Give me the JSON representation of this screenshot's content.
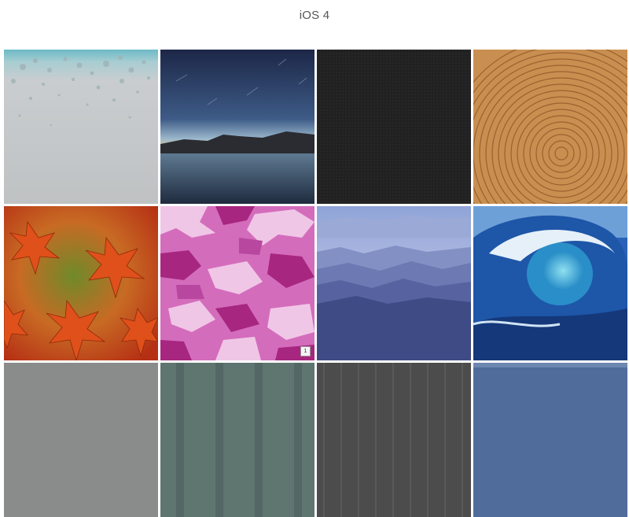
{
  "page": {
    "title": "iOS 4"
  },
  "wallpapers": [
    {
      "name": "water-drops",
      "color": "#bfc3c4"
    },
    {
      "name": "night-lake",
      "color": "#2b3a5c"
    },
    {
      "name": "dark-mesh",
      "color": "#222222"
    },
    {
      "name": "wood-rings",
      "color": "#c58b4a"
    },
    {
      "name": "maple-leaves",
      "color": "#d8501d"
    },
    {
      "name": "pink-camo",
      "color": "#cf62b4",
      "badge": "1"
    },
    {
      "name": "blue-mountains",
      "color": "#5d6aa7"
    },
    {
      "name": "ocean-wave",
      "color": "#2f74c8"
    },
    {
      "name": "gray-texture",
      "color": "#8a8c8c"
    },
    {
      "name": "green-stripes",
      "color": "#5f7570"
    },
    {
      "name": "dark-stripes",
      "color": "#4c4c4c"
    },
    {
      "name": "denim",
      "color": "#4f6c9a"
    }
  ]
}
